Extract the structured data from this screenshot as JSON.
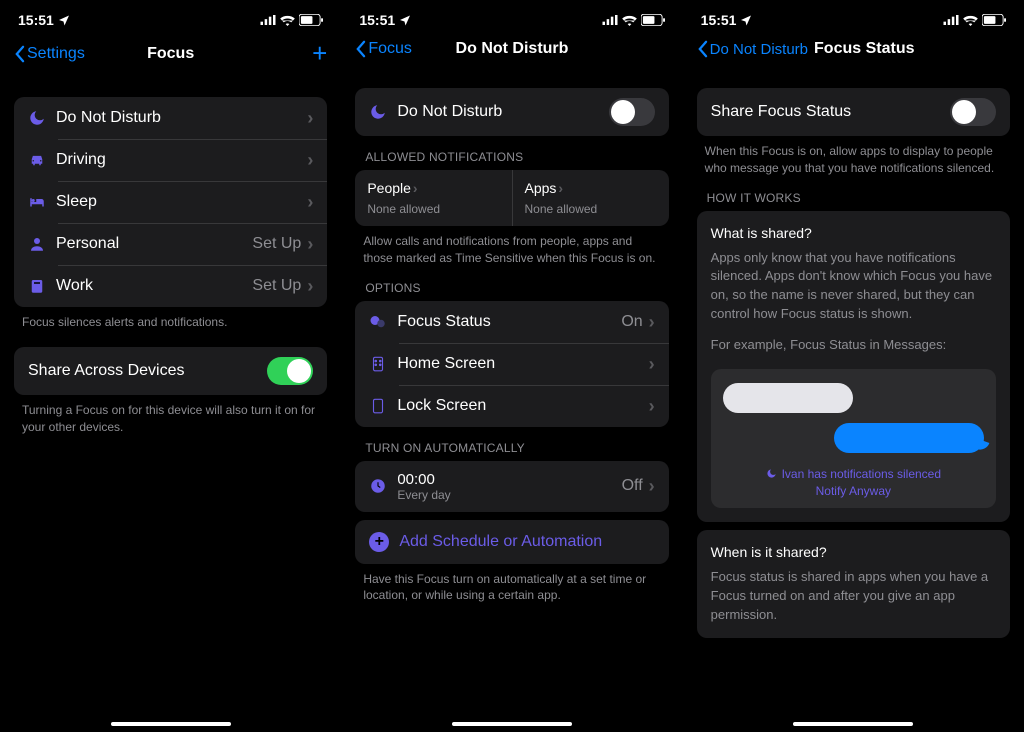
{
  "status": {
    "time": "15:51"
  },
  "panel1": {
    "back": "Settings",
    "title": "Focus",
    "items": [
      {
        "label": "Do Not Disturb",
        "value": "",
        "icon": "moon"
      },
      {
        "label": "Driving",
        "value": "",
        "icon": "car"
      },
      {
        "label": "Sleep",
        "value": "",
        "icon": "bed"
      },
      {
        "label": "Personal",
        "value": "Set Up",
        "icon": "person"
      },
      {
        "label": "Work",
        "value": "Set Up",
        "icon": "badge"
      }
    ],
    "footer1": "Focus silences alerts and notifications.",
    "share": "Share Across Devices",
    "shareOn": true,
    "footer2": "Turning a Focus on for this device will also turn it on for your other devices."
  },
  "panel2": {
    "back": "Focus",
    "title": "Do Not Disturb",
    "dnd": "Do Not Disturb",
    "dndOn": false,
    "allowedHeader": "ALLOWED NOTIFICATIONS",
    "people": "People",
    "peopleSub": "None allowed",
    "apps": "Apps",
    "appsSub": "None allowed",
    "allowedFooter": "Allow calls and notifications from people, apps and those marked as Time Sensitive when this Focus is on.",
    "optionsHeader": "OPTIONS",
    "focusStatus": "Focus Status",
    "focusStatusVal": "On",
    "homeScreen": "Home Screen",
    "lockScreen": "Lock Screen",
    "autoHeader": "TURN ON AUTOMATICALLY",
    "autoTime": "00:00",
    "autoSub": "Every day",
    "autoVal": "Off",
    "addSchedule": "Add Schedule or Automation",
    "autoFooter": "Have this Focus turn on automatically at a set time or location, or while using a certain app."
  },
  "panel3": {
    "back": "Do Not Disturb",
    "title": "Focus Status",
    "share": "Share Focus Status",
    "shareOn": false,
    "shareFooter": "When this Focus is on, allow apps to display to people who message you that you have notifications silenced.",
    "howHeader": "HOW IT WORKS",
    "whatTitle": "What is shared?",
    "whatText": "Apps only know that you have notifications silenced. Apps don't know which Focus you have on, so the name is never shared, but they can control how Focus status is shown.",
    "example": "For example, Focus Status in Messages:",
    "silenced": "Ivan has notifications silenced",
    "notify": "Notify Anyway",
    "whenTitle": "When is it shared?",
    "whenText": "Focus status is shared in apps when you have a Focus turned on and after you give an app permission."
  }
}
